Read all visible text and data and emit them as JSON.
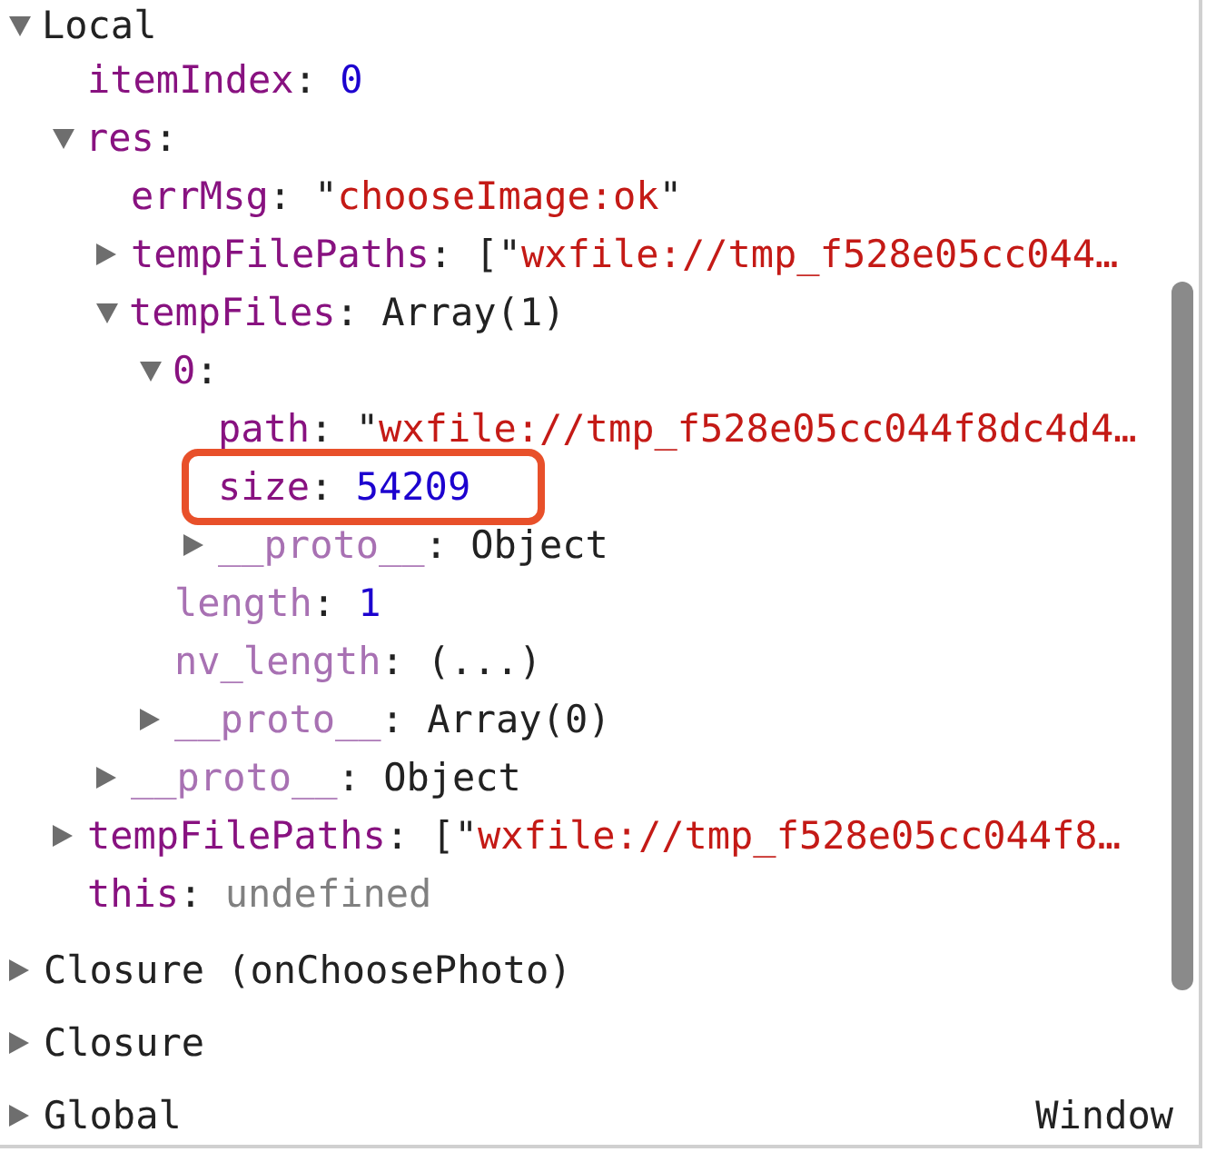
{
  "scopes": [
    {
      "name": "Local",
      "expanded": true,
      "children": [
        {
          "key": "itemIndex",
          "kind": "own",
          "value": [
            {
              "kind": "punct",
              "text": ": "
            },
            {
              "kind": "number",
              "text": "0"
            }
          ]
        },
        {
          "key": "res",
          "kind": "own",
          "expanded": true,
          "value": [
            {
              "kind": "punct",
              "text": ":"
            }
          ],
          "children": [
            {
              "key": "errMsg",
              "kind": "own",
              "value": [
                {
                  "kind": "punct",
                  "text": ": \""
                },
                {
                  "kind": "string",
                  "text": "chooseImage:ok"
                },
                {
                  "kind": "punct",
                  "text": "\""
                }
              ]
            },
            {
              "key": "tempFilePaths",
              "kind": "own",
              "expanded": false,
              "value": [
                {
                  "kind": "punct",
                  "text": ": [\""
                },
                {
                  "kind": "string",
                  "text": "wxfile://tmp_f528e05cc044…"
                }
              ]
            },
            {
              "key": "tempFiles",
              "kind": "own",
              "expanded": true,
              "value": [
                {
                  "kind": "punct",
                  "text": ": Array(1)"
                }
              ],
              "children": [
                {
                  "key": "0",
                  "kind": "own",
                  "expanded": true,
                  "value": [
                    {
                      "kind": "punct",
                      "text": ":"
                    }
                  ],
                  "children": [
                    {
                      "key": "path",
                      "kind": "own",
                      "value": [
                        {
                          "kind": "punct",
                          "text": ": \""
                        },
                        {
                          "kind": "string",
                          "text": "wxfile://tmp_f528e05cc044f8dc4d4…"
                        }
                      ]
                    },
                    {
                      "key": "size",
                      "kind": "own",
                      "highlighted": true,
                      "value": [
                        {
                          "kind": "punct",
                          "text": ": "
                        },
                        {
                          "kind": "number",
                          "text": "54209"
                        }
                      ]
                    },
                    {
                      "key": "__proto__",
                      "kind": "internal",
                      "expanded": false,
                      "value": [
                        {
                          "kind": "punct",
                          "text": ": Object"
                        }
                      ]
                    }
                  ]
                },
                {
                  "key": "length",
                  "kind": "internal",
                  "value": [
                    {
                      "kind": "punct",
                      "text": ": "
                    },
                    {
                      "kind": "number",
                      "text": "1"
                    }
                  ]
                },
                {
                  "key": "nv_length",
                  "kind": "internal",
                  "value": [
                    {
                      "kind": "punct",
                      "text": ": (...)"
                    }
                  ]
                },
                {
                  "key": "__proto__",
                  "kind": "internal",
                  "expanded": false,
                  "value": [
                    {
                      "kind": "punct",
                      "text": ": Array(0)"
                    }
                  ]
                }
              ]
            },
            {
              "key": "__proto__",
              "kind": "internal",
              "expanded": false,
              "value": [
                {
                  "kind": "punct",
                  "text": ": Object"
                }
              ]
            }
          ]
        },
        {
          "key": "tempFilePaths",
          "kind": "own",
          "expanded": false,
          "value": [
            {
              "kind": "punct",
              "text": ": [\""
            },
            {
              "kind": "string",
              "text": "wxfile://tmp_f528e05cc044f8…"
            }
          ]
        },
        {
          "key": "this",
          "kind": "own",
          "value": [
            {
              "kind": "punct",
              "text": ": "
            },
            {
              "kind": "undefined",
              "text": "undefined"
            }
          ]
        }
      ]
    },
    {
      "name": "Closure (onChoosePhoto)",
      "expanded": false
    },
    {
      "name": "Closure",
      "expanded": false
    },
    {
      "name": "Global",
      "expanded": false,
      "detail": "Window"
    }
  ]
}
